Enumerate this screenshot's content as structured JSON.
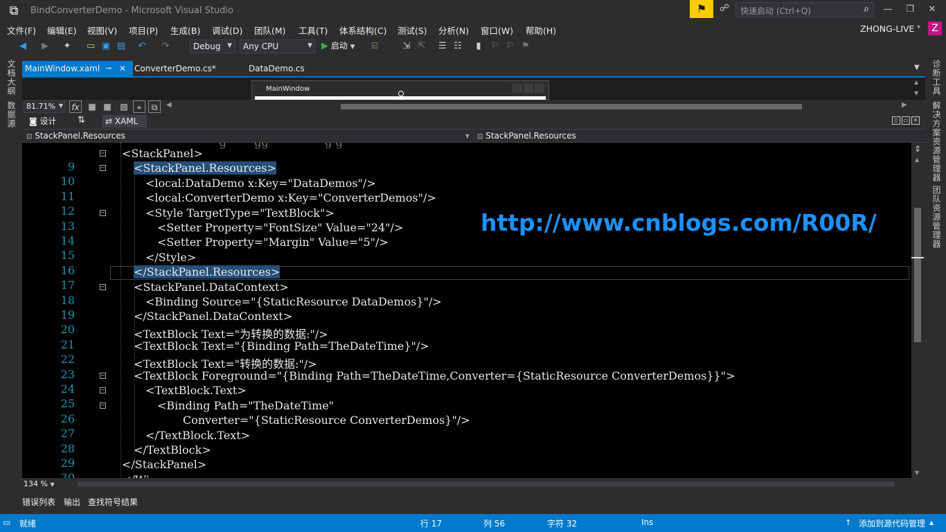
{
  "window": {
    "title": "BindConverterDemo - Microsoft Visual Studio",
    "quick_launch_placeholder": "快速启动 (Ctrl+Q)",
    "user": "ZHONG-LIVE",
    "avatar_letter": "Z"
  },
  "menu": [
    "文件(F)",
    "编辑(E)",
    "视图(V)",
    "项目(P)",
    "生成(B)",
    "调试(D)",
    "团队(M)",
    "工具(T)",
    "体系结构(C)",
    "测试(S)",
    "分析(N)",
    "窗口(W)",
    "帮助(H)"
  ],
  "toolbar": {
    "config": "Debug",
    "platform": "Any CPU",
    "run_label": "启动"
  },
  "left_rail": [
    "文档大纲",
    "数据源"
  ],
  "right_rail": [
    "诊断工具",
    "解决方案资源管理器",
    "团队资源管理器"
  ],
  "tabs": [
    {
      "label": "MainWindow.xaml",
      "active": true
    },
    {
      "label": "ConverterDemo.cs*",
      "active": false
    },
    {
      "label": "DataDemo.cs",
      "active": false
    }
  ],
  "designer": {
    "window_title": "MainWindow",
    "zoom": "81.71%"
  },
  "switch": {
    "design_label": "设计",
    "xaml_label": "XAML"
  },
  "nav": {
    "left": "StackPanel.Resources",
    "right": "StackPanel.Resources"
  },
  "editor": {
    "zoom": "134 %",
    "watermark": "http://www.cnblogs.com/R00R/",
    "lines": [
      {
        "num": "9",
        "text": "<StackPanel>"
      },
      {
        "num": "10",
        "text": "<StackPanel.Resources>"
      },
      {
        "num": "11",
        "text": "<local:DataDemo x:Key=\"DataDemos\"/>"
      },
      {
        "num": "12",
        "text": "<local:ConverterDemo x:Key=\"ConverterDemos\"/>"
      },
      {
        "num": "13",
        "text": "<Style TargetType=\"TextBlock\">"
      },
      {
        "num": "14",
        "text": "<Setter Property=\"FontSize\" Value=\"24\"/>"
      },
      {
        "num": "15",
        "text": "<Setter Property=\"Margin\" Value=\"5\"/>"
      },
      {
        "num": "16",
        "text": "</Style>"
      },
      {
        "num": "17",
        "text": "</StackPanel.Resources>"
      },
      {
        "num": "18",
        "text": "<StackPanel.DataContext>"
      },
      {
        "num": "19",
        "text": "<Binding Source=\"{StaticResource DataDemos}\"/>"
      },
      {
        "num": "20",
        "text": "</StackPanel.DataContext>"
      },
      {
        "num": "21",
        "text": "<TextBlock Text=\"为转换的数据:\"/>"
      },
      {
        "num": "22",
        "text": "<TextBlock Text=\"{Binding Path=TheDateTime}\"/>"
      },
      {
        "num": "23",
        "text": "<TextBlock Text=\"转换的数据:\"/>"
      },
      {
        "num": "24",
        "text": "<TextBlock Foreground=\"{Binding Path=TheDateTime,Converter={StaticResource ConverterDemos}}\">"
      },
      {
        "num": "25",
        "text": "<TextBlock.Text>"
      },
      {
        "num": "26",
        "text": "<Binding Path=\"TheDateTime\""
      },
      {
        "num": "27",
        "text": "Converter=\"{StaticResource ConverterDemos}\"/>"
      },
      {
        "num": "28",
        "text": "</TextBlock.Text>"
      },
      {
        "num": "29",
        "text": "</TextBlock>"
      },
      {
        "num": "30",
        "text": "</StackPanel>"
      }
    ]
  },
  "tool_tabs": [
    "错误列表",
    "输出",
    "查找符号结果"
  ],
  "status": {
    "ready": "就绪",
    "line": "行 17",
    "col": "列 56",
    "char": "字符 32",
    "mode": "Ins",
    "source_control": "添加到源代码管理"
  },
  "colors": {
    "accent": "#007acc",
    "notify": "#ffcc00",
    "watermark": "#1e90ff"
  }
}
